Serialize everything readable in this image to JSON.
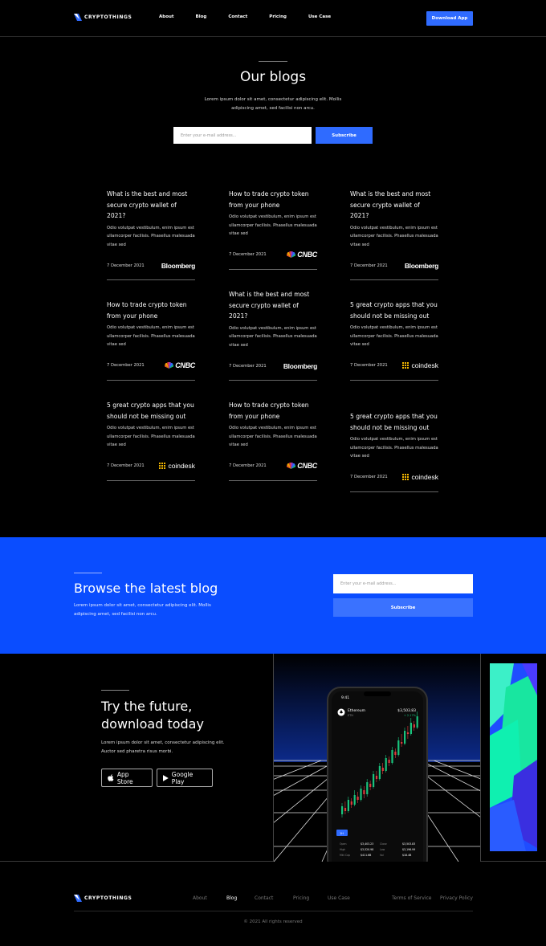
{
  "brand": {
    "name": "CRYPTOTHINGS"
  },
  "nav": {
    "links": [
      "About",
      "Blog",
      "Contact",
      "Pricing",
      "Use Case"
    ],
    "cta": "Download App"
  },
  "hero": {
    "title": "Our blogs",
    "description": "Lorem ipsum dolor sit amet, consectetur adipiscing elit. Mollis adipiscing amet, sed facilisi non arcu.",
    "email_placeholder": "Enter your e-mail address...",
    "subscribe": "Subscribe"
  },
  "posts": [
    {
      "title": "What is the best and most secure crypto wallet of 2021?",
      "body": "Odio volutpat vestibulum, enim ipsum est ullamcorper facilisis. Phasellus malesuada vitae sed",
      "date": "7 December 2021",
      "source": "Bloomberg"
    },
    {
      "title": "How to trade crypto token from your phone",
      "body": "Odio volutpat vestibulum, enim ipsum est ullamcorper facilisis. Phasellus malesuada vitae sed",
      "date": "7 December 2021",
      "source": "CNBC"
    },
    {
      "title": "What is the best and most secure crypto wallet of 2021?",
      "body": "Odio volutpat vestibulum, enim ipsum est ullamcorper facilisis. Phasellus malesuada vitae sed",
      "date": "7 December 2021",
      "source": "Bloomberg"
    },
    {
      "title": "How to trade crypto token from your phone",
      "body": "Odio volutpat vestibulum, enim ipsum est ullamcorper facilisis. Phasellus malesuada vitae sed",
      "date": "7 December 2021",
      "source": "CNBC"
    },
    {
      "title": "What is the best and most secure crypto wallet of 2021?",
      "body": "Odio volutpat vestibulum, enim ipsum est ullamcorper facilisis. Phasellus malesuada vitae sed",
      "date": "7 December 2021",
      "source": "Bloomberg"
    },
    {
      "title": "5 great crypto apps that you should not be missing out",
      "body": "Odio volutpat vestibulum, enim ipsum est ullamcorper facilisis. Phasellus malesuada vitae sed",
      "date": "7 December 2021",
      "source": "coindesk"
    },
    {
      "title": "5 great crypto apps that you should not be missing out",
      "body": "Odio volutpat vestibulum, enim ipsum est ullamcorper facilisis. Phasellus malesuada vitae sed",
      "date": "7 December 2021",
      "source": "coindesk"
    },
    {
      "title": "How to trade crypto token from your phone",
      "body": "Odio volutpat vestibulum, enim ipsum est ullamcorper facilisis. Phasellus malesuada vitae sed",
      "date": "7 December 2021",
      "source": "CNBC"
    },
    {
      "title": "5 great crypto apps that you should not be missing out",
      "body": "Odio volutpat vestibulum, enim ipsum est ullamcorper facilisis. Phasellus malesuada vitae sed",
      "date": "7 December 2021",
      "source": "coindesk"
    }
  ],
  "band": {
    "title": "Browse the latest blog",
    "description": "Lorem ipsum dolor sit amet, consectetur adipiscing elit. Mollis adipiscing amet, sed facilisi non arcu.",
    "email_placeholder": "Enter your e-mail address...",
    "subscribe": "Subscribe"
  },
  "download": {
    "title_line1": "Try the future,",
    "title_line2": "download today",
    "description": "Lorem ipsum dolor sit amet, consectetur adipiscing elit. Auctor sed pharetra risus morbi.",
    "app_store": "App Store",
    "google_play": "Google Play",
    "phone": {
      "time": "9:41",
      "coin": "Ethereum",
      "ticker": "ETH",
      "price": "$3,503.83",
      "change": "+ 2.17%",
      "tab": "1H",
      "stats": [
        "Open",
        "$3,403.23",
        "Close",
        "$3,503.83",
        "High",
        "$3,520.98",
        "Low",
        "$3,196.99",
        "Mkt Cap",
        "$411.6B",
        "Vol",
        "$18.4B"
      ]
    }
  },
  "footer": {
    "links": [
      "About",
      "Blog",
      "Contact",
      "Pricing",
      "Use Case"
    ],
    "legal": [
      "Terms of Service",
      "Privacy Policy"
    ],
    "copyright": "© 2021 All rights reserved"
  },
  "colors": {
    "accent": "#2f6bff",
    "band": "#0a4dff",
    "bg": "#000000",
    "candle_up": "#19c37d",
    "candle_down": "#e0383c"
  }
}
